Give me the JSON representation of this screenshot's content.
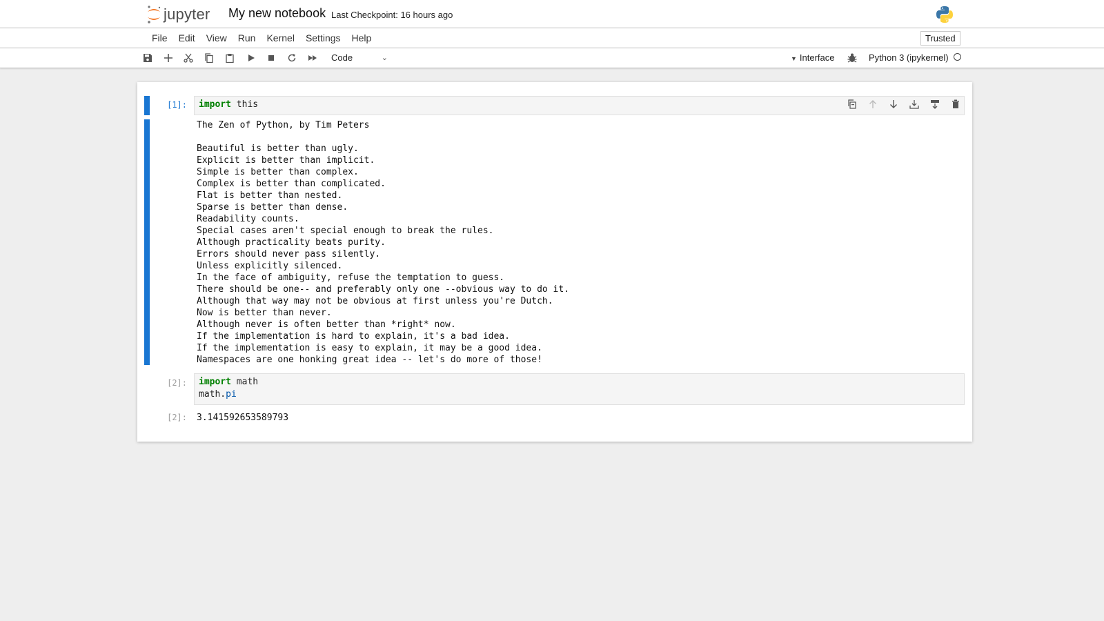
{
  "header": {
    "logo_text": "jupyter",
    "notebook_title": "My new notebook",
    "checkpoint": "Last Checkpoint: 16 hours ago"
  },
  "menu": {
    "items": [
      "File",
      "Edit",
      "View",
      "Run",
      "Kernel",
      "Settings",
      "Help"
    ],
    "trusted": "Trusted"
  },
  "toolbar": {
    "cell_type": "Code",
    "interface": "Interface",
    "kernel": "Python 3 (ipykernel)"
  },
  "cells": [
    {
      "prompt": "[1]:",
      "code_keyword": "import",
      "code_rest": " this",
      "output_lines": [
        "The Zen of Python, by Tim Peters",
        "",
        "Beautiful is better than ugly.",
        "Explicit is better than implicit.",
        "Simple is better than complex.",
        "Complex is better than complicated.",
        "Flat is better than nested.",
        "Sparse is better than dense.",
        "Readability counts.",
        "Special cases aren't special enough to break the rules.",
        "Although practicality beats purity.",
        "Errors should never pass silently.",
        "Unless explicitly silenced.",
        "In the face of ambiguity, refuse the temptation to guess.",
        "There should be one-- and preferably only one --obvious way to do it.",
        "Although that way may not be obvious at first unless you're Dutch.",
        "Now is better than never.",
        "Although never is often better than *right* now.",
        "If the implementation is hard to explain, it's a bad idea.",
        "If the implementation is easy to explain, it may be a good idea.",
        "Namespaces are one honking great idea -- let's do more of those!"
      ]
    },
    {
      "prompt": "[2]:",
      "line1_keyword": "import",
      "line1_rest": " math",
      "line2_obj": "math.",
      "line2_attr": "pi",
      "output_prompt": "[2]:",
      "output": "3.141592653589793"
    }
  ],
  "colors": {
    "accent": "#1976d2",
    "background": "#eeeeee",
    "keyword": "#008000"
  }
}
